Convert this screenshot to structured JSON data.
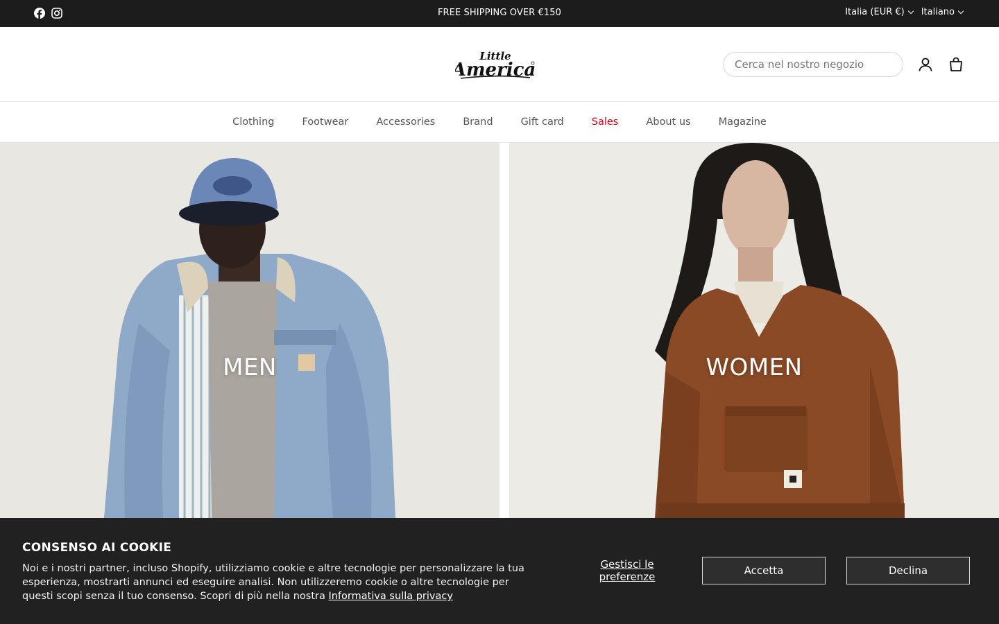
{
  "topbar": {
    "announcement": "FREE SHIPPING OVER €150",
    "country_selector": "Italia (EUR €)",
    "language_selector": "Italiano",
    "social_icons": [
      "facebook-icon",
      "instagram-icon"
    ]
  },
  "header": {
    "logo_text": [
      "Little",
      "America"
    ],
    "search_placeholder": "Cerca nel nostro negozio",
    "icons": [
      "account-icon",
      "cart-icon"
    ]
  },
  "nav": {
    "items": [
      {
        "label": "Clothing"
      },
      {
        "label": "Footwear"
      },
      {
        "label": "Accessories"
      },
      {
        "label": "Brand"
      },
      {
        "label": "Gift card"
      },
      {
        "label": "Sales",
        "color": "#d0021b"
      },
      {
        "label": "About us"
      },
      {
        "label": "Magazine"
      }
    ]
  },
  "hero": {
    "men_label": "MEN",
    "women_label": "WOMEN"
  },
  "cookie": {
    "title": "CONSENSO AI COOKIE",
    "body": "Noi e i nostri partner, incluso Shopify, utilizziamo cookie e altre tecnologie per personalizzare la tua esperienza, mostrarti annunci ed eseguire analisi. Non utilizzeremo cookie o altre tecnologie per questi scopi senza il tuo consenso. Scopri di più nella nostra ",
    "privacy_link": "Informativa sulla privacy",
    "manage_label": "Gestisci le preferenze",
    "accept_label": "Accetta",
    "decline_label": "Declina"
  },
  "colors": {
    "topbar_bg": "#1c1c1c",
    "cookie_bg": "#212121",
    "sale_red": "#d0021b"
  }
}
